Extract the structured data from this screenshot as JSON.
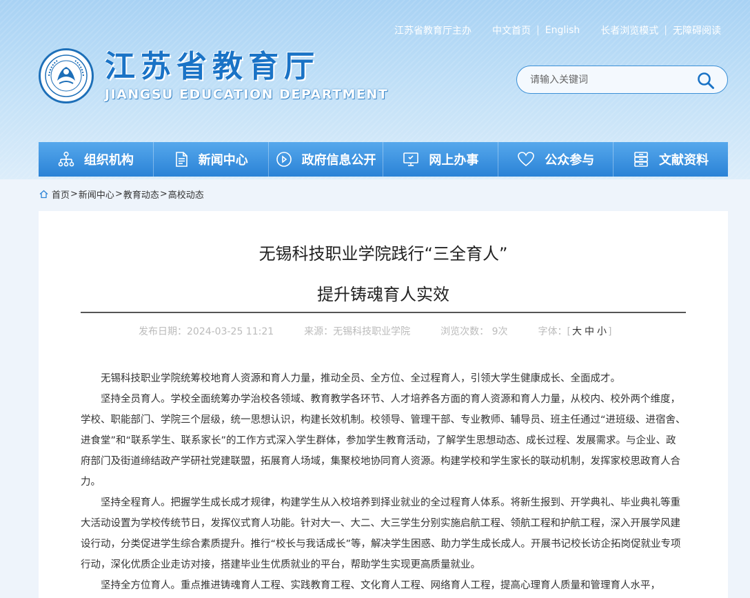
{
  "header": {
    "top_links": [
      "江苏省教育厅主办",
      "中文首页",
      "English",
      "长者浏览模式",
      "无障碍阅读"
    ],
    "logo_cn": "江苏省教育厅",
    "logo_en": "JIANGSU EDUCATION DEPARTMENT",
    "search_placeholder": "请输入关键词"
  },
  "nav": [
    {
      "label": "组织机构",
      "icon": "org-chart-icon"
    },
    {
      "label": "新闻中心",
      "icon": "document-icon"
    },
    {
      "label": "政府信息公开",
      "icon": "play-circle-icon"
    },
    {
      "label": "网上办事",
      "icon": "monitor-icon"
    },
    {
      "label": "公众参与",
      "icon": "heart-icon"
    },
    {
      "label": "文献资料",
      "icon": "archive-icon"
    }
  ],
  "breadcrumb": [
    "首页",
    "新闻中心",
    "教育动态",
    "高校动态"
  ],
  "article": {
    "title_line1": "无锡科技职业学院践行“三全育人”",
    "title_line2": "提升铸魂育人实效",
    "publish_date": "发布日期：2024-03-25 11:21",
    "source": "来源：无锡科技职业学院",
    "views": "浏览次数： 9次",
    "font_label": "字体：[",
    "font_large": "大",
    "font_medium": "中",
    "font_small": "小",
    "font_close": "]",
    "paragraphs": [
      "无锡科技职业学院统筹校地育人资源和育人力量，推动全员、全方位、全过程育人，引领大学生健康成长、全面成才。",
      "坚持全员育人。学校全面统筹办学治校各领域、教育教学各环节、人才培养各方面的育人资源和育人力量，从校内、校外两个维度，学校、职能部门、学院三个层级，统一思想认识，构建长效机制。校领导、管理干部、专业教师、辅导员、班主任通过“进班级、进宿舍、进食堂”和“联系学生、联系家长”的工作方式深入学生群体，参加学生教育活动，了解学生思想动态、成长过程、发展需求。与企业、政府部门及街道缔结政产学研社党建联盟，拓展育人场域，集聚校地协同育人资源。构建学校和学生家长的联动机制，发挥家校思政育人合力。",
      "坚持全程育人。把握学生成长成才规律，构建学生从入校培养到择业就业的全过程育人体系。将新生报到、开学典礼、毕业典礼等重大活动设置为学校传统节日，发挥仪式育人功能。针对大一、大二、大三学生分别实施启航工程、领航工程和护航工程，深入开展学风建设行动，分类促进学生综合素质提升。推行“校长与我话成长”等，解决学生困惑、助力学生成长成人。开展书记校长访企拓岗促就业专项行动，深化优质企业走访对接，搭建毕业生优质就业的平台，帮助学生实现更高质量就业。",
      "坚持全方位育人。重点推进铸魂育人工程、实践教育工程、文化育人工程、网络育人工程，提高心理育人质量和管理育人水平，"
    ]
  }
}
